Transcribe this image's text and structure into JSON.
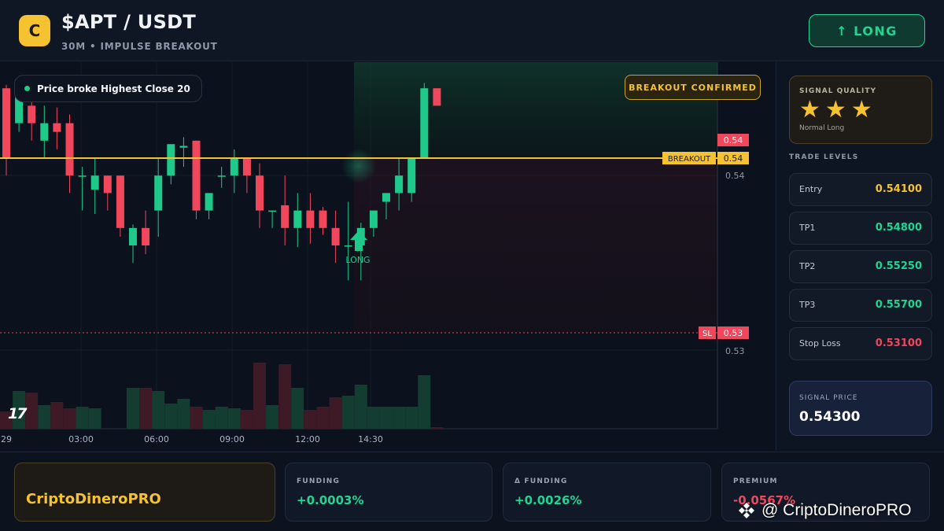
{
  "header": {
    "logo_letter": "C",
    "title": "$APT / USDT",
    "subtitle": "30M • IMPULSE BREAKOUT",
    "signal_button": "↑ LONG"
  },
  "chart": {
    "condition": "Price broke Highest Close 20",
    "confirmation": "BREAKOUT CONFIRMED",
    "price_tags": {
      "current": "0.54",
      "breakout_label": "BREAKOUT",
      "breakout_value": "0.54",
      "sl_label": "SL",
      "sl_value": "0.53"
    },
    "axis_ticks": [
      "0.54",
      "0.53"
    ],
    "time_ticks": [
      "29",
      "03:00",
      "06:00",
      "09:00",
      "12:00",
      "14:30"
    ],
    "marker_label": "LONG",
    "tv_logo": "17",
    "colors": {
      "up": "#1fc98a",
      "down": "#f0475d",
      "breakout": "#f5c232"
    }
  },
  "chart_data": {
    "type": "candlestick",
    "x": [
      "29",
      "03:00",
      "06:00",
      "09:00",
      "12:00",
      "14:30"
    ],
    "candles": [
      {
        "o": 0.545,
        "h": 0.5452,
        "c": 0.541,
        "l": 0.54
      },
      {
        "o": 0.543,
        "h": 0.5455,
        "c": 0.5455,
        "l": 0.5425
      },
      {
        "o": 0.544,
        "h": 0.545,
        "c": 0.543,
        "l": 0.542
      },
      {
        "o": 0.542,
        "h": 0.544,
        "c": 0.543,
        "l": 0.541
      },
      {
        "o": 0.543,
        "h": 0.5439,
        "c": 0.5425,
        "l": 0.5415
      },
      {
        "o": 0.543,
        "h": 0.5435,
        "c": 0.54,
        "l": 0.539
      },
      {
        "o": 0.54,
        "h": 0.5405,
        "c": 0.54,
        "l": 0.538
      },
      {
        "o": 0.5392,
        "h": 0.541,
        "c": 0.54,
        "l": 0.5378
      },
      {
        "o": 0.54,
        "h": 0.54,
        "c": 0.539,
        "l": 0.538
      },
      {
        "o": 0.54,
        "h": 0.54,
        "c": 0.537,
        "l": 0.5365
      },
      {
        "o": 0.536,
        "h": 0.5372,
        "c": 0.537,
        "l": 0.535
      },
      {
        "o": 0.537,
        "h": 0.538,
        "c": 0.536,
        "l": 0.5355
      },
      {
        "o": 0.538,
        "h": 0.541,
        "c": 0.54,
        "l": 0.5365
      },
      {
        "o": 0.54,
        "h": 0.5413,
        "c": 0.5418,
        "l": 0.5395
      },
      {
        "o": 0.5416,
        "h": 0.5422,
        "c": 0.5417,
        "l": 0.5405
      },
      {
        "o": 0.542,
        "h": 0.542,
        "c": 0.538,
        "l": 0.5375
      },
      {
        "o": 0.538,
        "h": 0.539,
        "c": 0.539,
        "l": 0.5375
      },
      {
        "o": 0.54,
        "h": 0.5405,
        "c": 0.54,
        "l": 0.5393
      },
      {
        "o": 0.54,
        "h": 0.5415,
        "c": 0.541,
        "l": 0.539
      },
      {
        "o": 0.541,
        "h": 0.541,
        "c": 0.54,
        "l": 0.539
      },
      {
        "o": 0.54,
        "h": 0.5407,
        "c": 0.538,
        "l": 0.537
      },
      {
        "o": 0.538,
        "h": 0.538,
        "c": 0.538,
        "l": 0.537
      },
      {
        "o": 0.5383,
        "h": 0.54,
        "c": 0.537,
        "l": 0.536
      },
      {
        "o": 0.537,
        "h": 0.539,
        "c": 0.538,
        "l": 0.5359
      },
      {
        "o": 0.538,
        "h": 0.539,
        "c": 0.537,
        "l": 0.5361
      },
      {
        "o": 0.538,
        "h": 0.5382,
        "c": 0.537,
        "l": 0.5366
      },
      {
        "o": 0.537,
        "h": 0.538,
        "c": 0.536,
        "l": 0.535
      },
      {
        "o": 0.536,
        "h": 0.5385,
        "c": 0.536,
        "l": 0.534
      },
      {
        "o": 0.536,
        "h": 0.5373,
        "c": 0.537,
        "l": 0.534
      },
      {
        "o": 0.537,
        "h": 0.538,
        "c": 0.538,
        "l": 0.5365
      },
      {
        "o": 0.5385,
        "h": 0.539,
        "c": 0.539,
        "l": 0.5375
      },
      {
        "o": 0.539,
        "h": 0.541,
        "c": 0.54,
        "l": 0.538
      },
      {
        "o": 0.539,
        "h": 0.541,
        "c": 0.541,
        "l": 0.5385
      },
      {
        "o": 0.541,
        "h": 0.5453,
        "c": 0.545,
        "l": 0.541
      },
      {
        "o": 0.545,
        "h": 0.545,
        "c": 0.544,
        "l": 0.544
      }
    ],
    "breakout_level": 0.541,
    "stop_loss": 0.531,
    "y_ticks": [
      0.54,
      0.53
    ]
  },
  "right_panel": {
    "quality_title": "SIGNAL QUALITY",
    "stars": 3,
    "quality_note": "Normal Long",
    "levels_title": "TRADE LEVELS",
    "levels": [
      {
        "label": "Entry",
        "value": "0.54100",
        "color": "#f5c232"
      },
      {
        "label": "TP1",
        "value": "0.54800",
        "color": "#1fd592"
      },
      {
        "label": "TP2",
        "value": "0.55250",
        "color": "#1fd592"
      },
      {
        "label": "TP3",
        "value": "0.55700",
        "color": "#1fd592"
      },
      {
        "label": "Stop Loss",
        "value": "0.53100",
        "color": "#f0475d"
      }
    ],
    "signal_price_label": "SIGNAL PRICE",
    "signal_price": "0.54300"
  },
  "bottom": {
    "brand": "CriptoDineroPRO",
    "metrics": [
      {
        "label": "FUNDING",
        "value": "+0.0003%",
        "color": "#1fd592"
      },
      {
        "label": "Δ FUNDING",
        "value": "+0.0026%",
        "color": "#1fd592"
      },
      {
        "label": "PREMIUM",
        "value": "-0.0567%",
        "color": "#f0475d"
      }
    ],
    "watermark": "@ CriptoDineroPRO"
  }
}
